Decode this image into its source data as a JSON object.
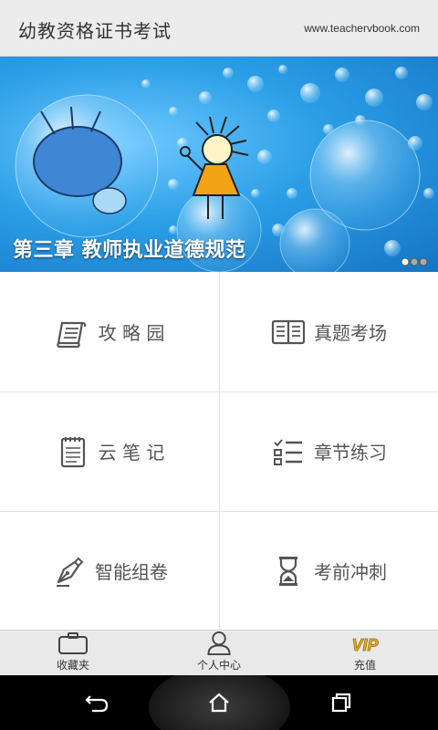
{
  "header": {
    "title": "幼教资格证书考试",
    "site": "www.teachervbook.com"
  },
  "banner": {
    "caption": "第三章 教师执业道德规范",
    "indicator_count": 3
  },
  "menu": {
    "strategy": "攻 略 园",
    "real_exam": "真题考场",
    "cloud_notes": "云 笔 记",
    "chapter_practice": "章节练习",
    "smart_paper": "智能组卷",
    "sprint": "考前冲刺"
  },
  "tabbar": {
    "favorites": "收藏夹",
    "profile": "个人中心",
    "recharge": "充值",
    "vip_badge": "VIP"
  },
  "colors": {
    "header_bg": "#ececec",
    "banner_blue": "#2a9ee6",
    "icon_gray": "#555555",
    "vip_gold": "#e6b422"
  },
  "icons": [
    "scroll-icon",
    "open-book-icon",
    "notepad-icon",
    "checklist-icon",
    "pen-nib-icon",
    "hourglass-icon",
    "briefcase-icon",
    "person-icon",
    "vip-icon",
    "back-icon",
    "home-icon",
    "recents-icon"
  ]
}
